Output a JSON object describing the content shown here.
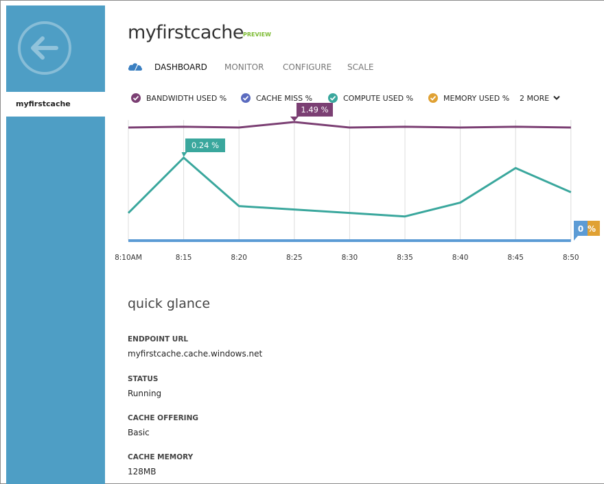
{
  "sidebar": {
    "items": [
      {
        "label": "myfirstcache"
      }
    ]
  },
  "header": {
    "title": "myfirstcache",
    "badge": "PREVIEW"
  },
  "tabs": [
    {
      "label": "DASHBOARD",
      "active": true
    },
    {
      "label": "MONITOR",
      "active": false
    },
    {
      "label": "CONFIGURE",
      "active": false
    },
    {
      "label": "SCALE",
      "active": false
    }
  ],
  "legend": {
    "items": [
      {
        "label": "BANDWIDTH USED %",
        "color": "#7b3f73"
      },
      {
        "label": "CACHE MISS %",
        "color": "#5b6bbf"
      },
      {
        "label": "COMPUTE USED %",
        "color": "#3aa79d"
      },
      {
        "label": "MEMORY USED %",
        "color": "#e0a133"
      }
    ],
    "more": "2 MORE"
  },
  "chart_data": {
    "type": "line",
    "x": [
      "8:10AM",
      "8:15",
      "8:20",
      "8:25",
      "8:30",
      "8:35",
      "8:40",
      "8:45",
      "8:50"
    ],
    "ylim": [
      0,
      1.6
    ],
    "series": [
      {
        "name": "BANDWIDTH USED %",
        "color": "#7b3f73",
        "values": [
          1.42,
          1.43,
          1.42,
          1.49,
          1.42,
          1.43,
          1.42,
          1.43,
          1.42
        ]
      },
      {
        "name": "COMPUTE USED %",
        "color": "#3aa79d",
        "values": [
          0.08,
          0.24,
          0.1,
          0.09,
          0.08,
          0.07,
          0.11,
          0.21,
          0.14
        ]
      },
      {
        "name": "CACHE MISS %",
        "color": "#5b9bd5",
        "values": [
          0,
          0,
          0,
          0,
          0,
          0,
          0,
          0,
          0
        ]
      }
    ],
    "annotations": [
      {
        "text": "1.49 %",
        "color": "#7b3f73"
      },
      {
        "text": "0.24 %",
        "color": "#3aa79d"
      },
      {
        "text": "0",
        "color": "#5b9bd5"
      },
      {
        "text": "%",
        "color": "#e0a133"
      }
    ],
    "grid": true
  },
  "quick_glance": {
    "title": "quick glance",
    "fields": [
      {
        "label": "ENDPOINT URL",
        "value": "myfirstcache.cache.windows.net"
      },
      {
        "label": "STATUS",
        "value": "Running"
      },
      {
        "label": "CACHE OFFERING",
        "value": "Basic"
      },
      {
        "label": "CACHE MEMORY",
        "value": "128MB"
      }
    ]
  }
}
